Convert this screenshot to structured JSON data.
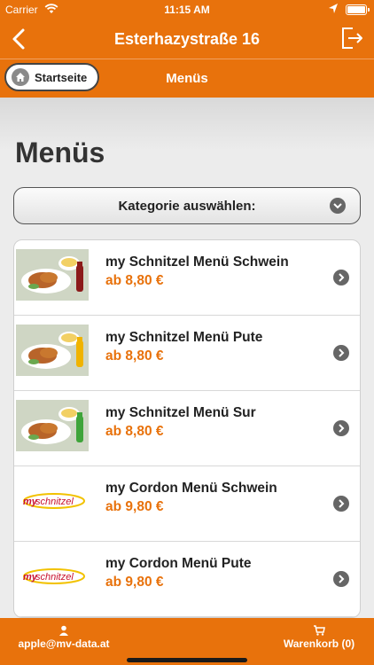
{
  "status": {
    "carrier": "Carrier",
    "time": "11:15 AM"
  },
  "nav": {
    "title": "Esterhazystraße 16"
  },
  "subnav": {
    "home_label": "Startseite",
    "section": "Menüs"
  },
  "page": {
    "title": "Menüs",
    "category_label": "Kategorie auswählen:"
  },
  "items": [
    {
      "name": "my Schnitzel Menü Schwein",
      "price": "ab 8,80 €",
      "image": "schnitzel-cola"
    },
    {
      "name": "my Schnitzel Menü Pute",
      "price": "ab 8,80 €",
      "image": "schnitzel-orange"
    },
    {
      "name": "my Schnitzel Menü Sur",
      "price": "ab 8,80 €",
      "image": "schnitzel-sprite"
    },
    {
      "name": "my Cordon Menü Schwein",
      "price": "ab 9,80 €",
      "image": "myschnitzel-logo"
    },
    {
      "name": "my Cordon Menü Pute",
      "price": "ab 9,80 €",
      "image": "myschnitzel-logo"
    }
  ],
  "footer": {
    "user_email": "apple@mv-data.at",
    "cart_label": "Warenkorb (0)"
  },
  "colors": {
    "accent": "#e8720c",
    "price": "#e8720c"
  }
}
